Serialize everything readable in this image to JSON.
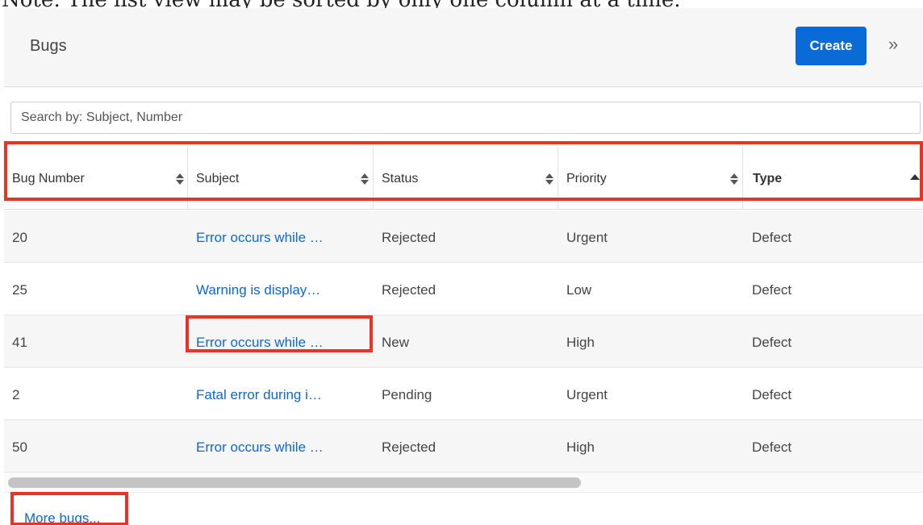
{
  "note": "Note: The list view may be sorted by only one column at a time.",
  "dashlet": {
    "title": "Bugs",
    "create_label": "Create",
    "expand_glyph": "»"
  },
  "search": {
    "placeholder": "Search by: Subject, Number",
    "value": ""
  },
  "table": {
    "columns": [
      {
        "label": "Bug Number",
        "sort": "none"
      },
      {
        "label": "Subject",
        "sort": "none"
      },
      {
        "label": "Status",
        "sort": "none"
      },
      {
        "label": "Priority",
        "sort": "none"
      },
      {
        "label": "Type",
        "sort": "ascending"
      }
    ],
    "rows": [
      {
        "number": "20",
        "subject": "Error occurs while …",
        "status": "Rejected",
        "priority": "Urgent",
        "type": "Defect"
      },
      {
        "number": "25",
        "subject": "Warning is display…",
        "status": "Rejected",
        "priority": "Low",
        "type": "Defect"
      },
      {
        "number": "41",
        "subject": "Error occurs while …",
        "status": "New",
        "priority": "High",
        "type": "Defect"
      },
      {
        "number": "2",
        "subject": "Fatal error during i…",
        "status": "Pending",
        "priority": "Urgent",
        "type": "Defect"
      },
      {
        "number": "50",
        "subject": "Error occurs while …",
        "status": "Rejected",
        "priority": "High",
        "type": "Defect"
      }
    ]
  },
  "footer": {
    "more_label": "More bugs..."
  },
  "colors": {
    "accent": "#0a6bd6",
    "link": "#0b68d6",
    "highlight": "#ea3323",
    "header_bg": "#f6f6f6"
  },
  "icons": [
    "sort-both-icon",
    "sort-ascending-icon",
    "double-chevron-right-icon"
  ]
}
